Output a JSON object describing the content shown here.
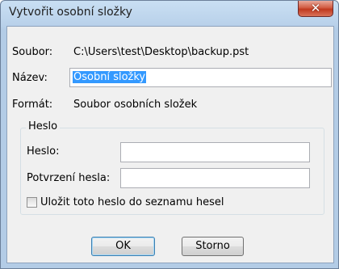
{
  "window": {
    "title": "Vytvořit osobní složky"
  },
  "form": {
    "file_label": "Soubor:",
    "file_value": "C:\\Users\\test\\Desktop\\backup.pst",
    "name_label": "Název:",
    "name_value": "Osobní složky",
    "format_label": "Formát:",
    "format_value": "Soubor osobních složek"
  },
  "password_group": {
    "legend": "Heslo",
    "password_label": "Heslo:",
    "password_value": "",
    "confirm_label": "Potvrzení hesla:",
    "confirm_value": "",
    "save_label": "Uložit toto heslo do seznamu hesel",
    "save_checked": false
  },
  "buttons": {
    "ok": "OK",
    "cancel": "Storno"
  },
  "icons": {
    "close": "close-icon"
  }
}
